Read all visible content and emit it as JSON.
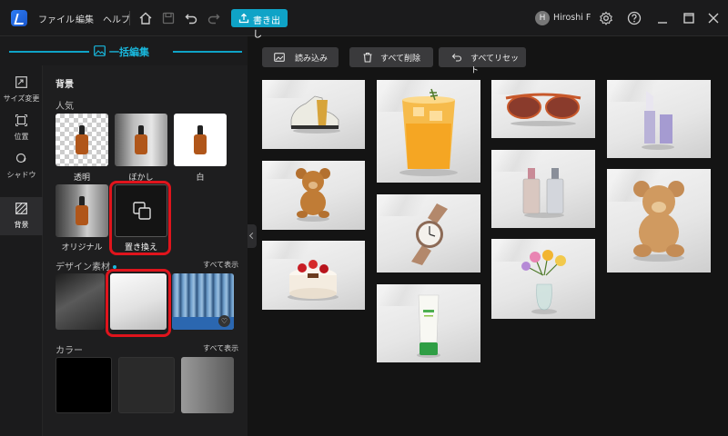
{
  "menu": {
    "file": "ファイル",
    "edit": "編集",
    "help": "ヘルプ"
  },
  "toolbar": {
    "export_label": "書き出し"
  },
  "user": {
    "initial": "H",
    "name": "Hiroshi F"
  },
  "panel": {
    "title": "一括編集"
  },
  "nav": [
    {
      "label": "サイズ変更",
      "icon": "resize-icon"
    },
    {
      "label": "位置",
      "icon": "position-icon"
    },
    {
      "label": "シャドウ",
      "icon": "shadow-icon"
    },
    {
      "label": "背景",
      "icon": "background-icon",
      "active": true
    }
  ],
  "background": {
    "heading": "背景",
    "popular_heading": "人気",
    "options": [
      "透明",
      "ぼかし",
      "白",
      "オリジナル",
      "置き換え"
    ]
  },
  "design": {
    "heading": "デザイン素材",
    "show_all": "すべて表示"
  },
  "color": {
    "heading": "カラー",
    "show_all": "すべて表示",
    "swatches": [
      "#000000",
      "#2a2a2a",
      "#8a8a8a"
    ]
  },
  "actions": {
    "import": "読み込み",
    "delete_all": "すべて削除",
    "reset_all": "すべてリセット"
  },
  "colors": {
    "accent": "#0fa3c7",
    "highlight": "#e0141c"
  }
}
